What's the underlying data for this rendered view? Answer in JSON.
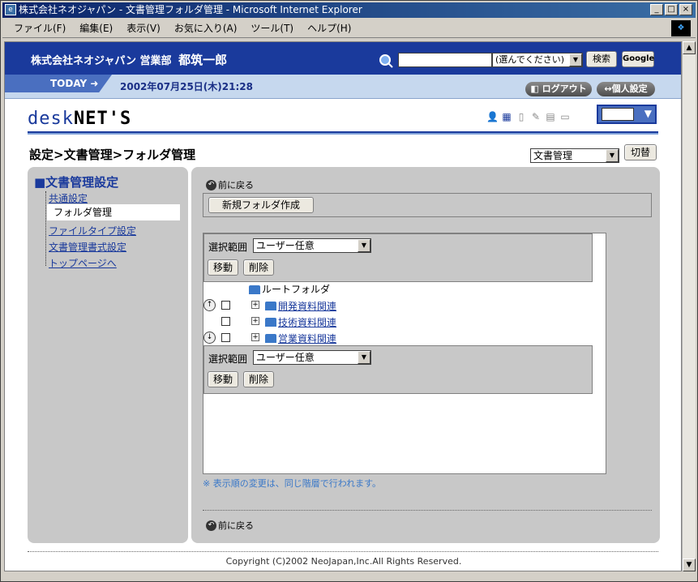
{
  "window": {
    "title": "株式会社ネオジャパン - 文書管理フォルダ管理 - Microsoft Internet Explorer",
    "controls": [
      "_",
      "□",
      "×"
    ]
  },
  "menu": [
    "ファイル(F)",
    "編集(E)",
    "表示(V)",
    "お気に入り(A)",
    "ツール(T)",
    "ヘルプ(H)"
  ],
  "header": {
    "company": "株式会社ネオジャパン 営業部",
    "user_name": "都筑一郎",
    "search_value": "",
    "scope_selected": "(選んでください)",
    "search_button": "検索",
    "google_button": "Google"
  },
  "today": {
    "label": "TODAY",
    "date": "2002年07月25日(木)21:28",
    "logout": "ログアウト",
    "personal_settings": "個人設定"
  },
  "logo": {
    "part1": "desk",
    "part2": "NET'S"
  },
  "breadcrumb": "設定>文書管理>フォルダ管理",
  "module": {
    "selected": "文書管理",
    "switch_button": "切替"
  },
  "sidebar": {
    "title": "■文書管理設定",
    "items": [
      {
        "label": "共通設定"
      },
      {
        "label": "フォルダ管理"
      },
      {
        "label": "ファイルタイプ設定"
      },
      {
        "label": "文書管理書式設定"
      },
      {
        "label": "トップページへ"
      }
    ]
  },
  "main": {
    "back_label": "前に戻る",
    "new_folder_button": "新規フォルダ作成",
    "scope_label": "選択範囲",
    "scope_value": "ユーザー任意",
    "move_button": "移動",
    "delete_button": "削除",
    "root_folder": "ルートフォルダ",
    "folders": [
      {
        "name": "開発資料関連"
      },
      {
        "name": "技術資料関連"
      },
      {
        "name": "営業資料関連"
      }
    ],
    "tree_expand": "+",
    "note": "※ 表示順の変更は、同じ階層で行われます。"
  },
  "footer": {
    "copyright": "Copyright (C)2002 NeoJapan,Inc.All Rights Reserved."
  }
}
